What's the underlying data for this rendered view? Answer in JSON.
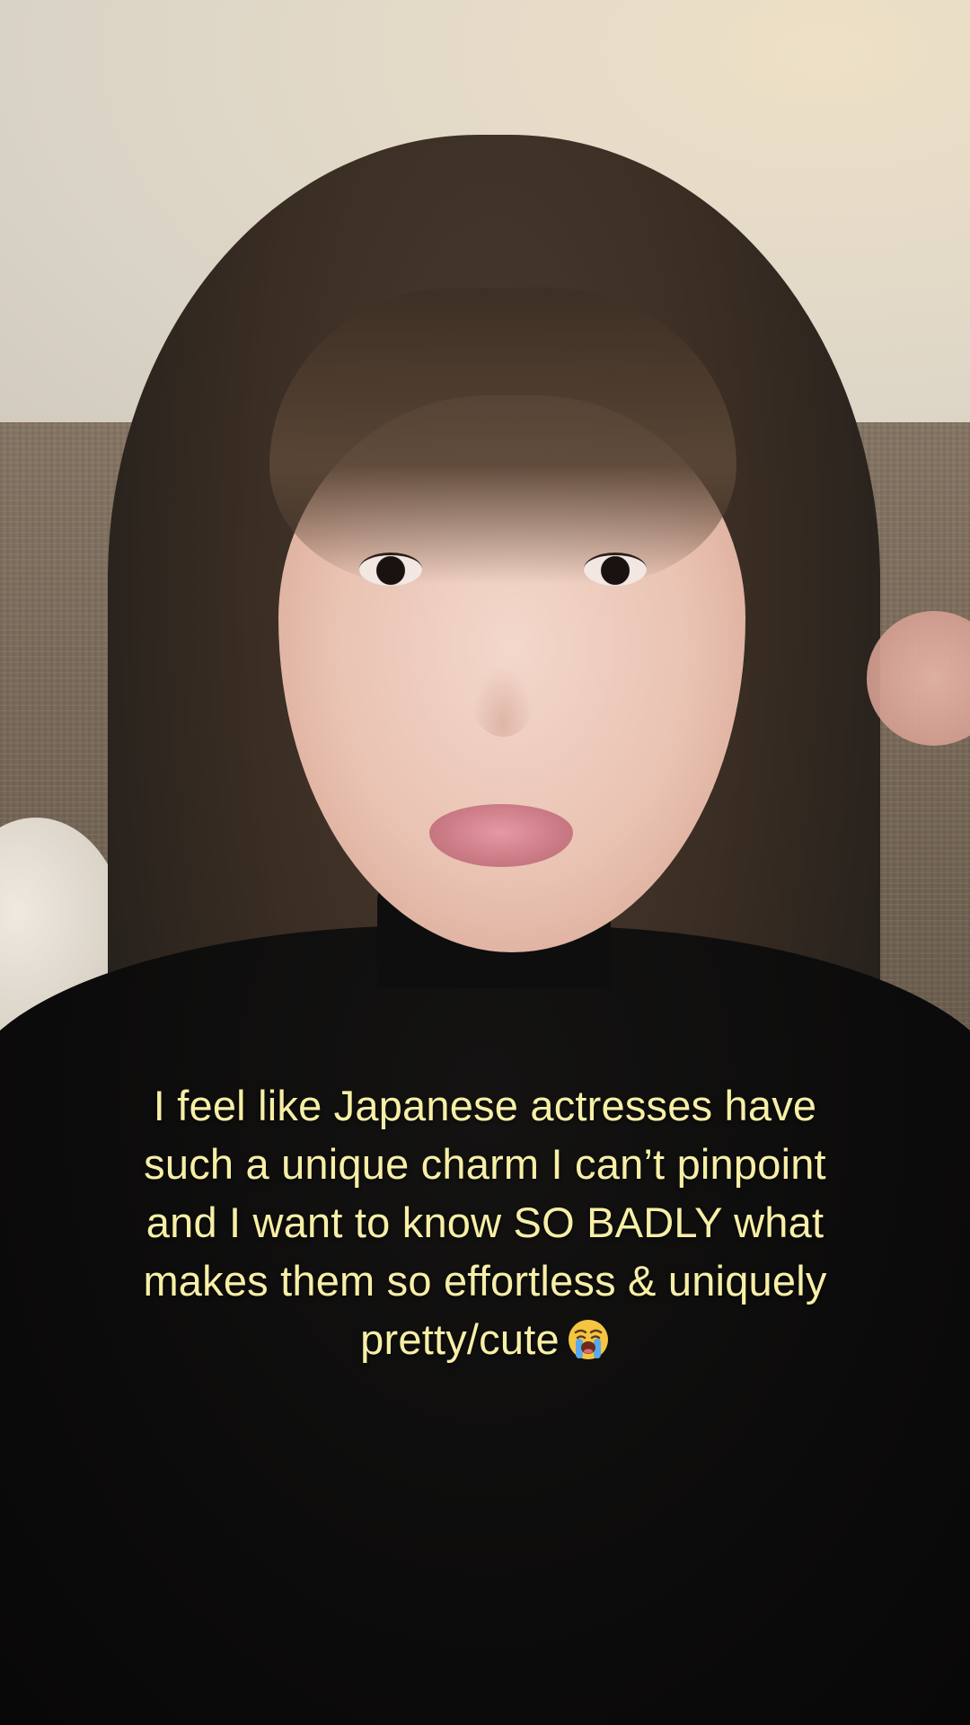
{
  "scene": {
    "description_icon": "video-frame"
  },
  "caption": {
    "text": "I feel like Japanese actresses have such a unique charm I can’t pinpoint and I want to know SO BADLY what makes them so effortless & uniquely pretty/cute",
    "emoji_name": "loudly-crying-face-icon",
    "color": "#f7efa6"
  }
}
